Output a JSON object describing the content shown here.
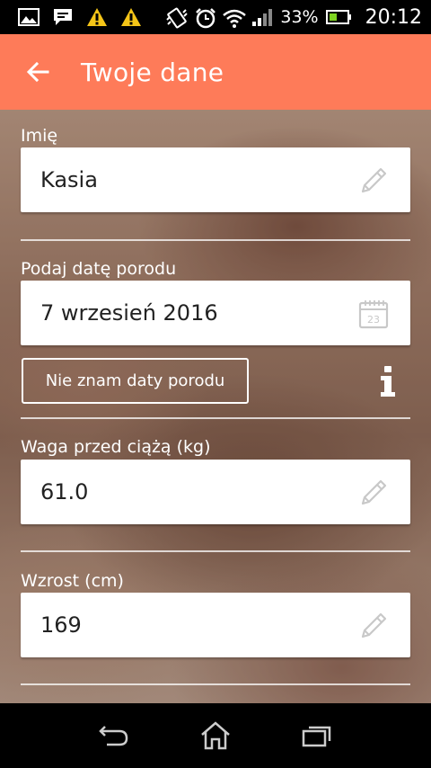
{
  "status_bar": {
    "battery_percent": "33%",
    "time": "20:12"
  },
  "app_bar": {
    "title": "Twoje dane"
  },
  "form": {
    "name": {
      "label": "Imię",
      "value": "Kasia"
    },
    "due_date": {
      "label": "Podaj datę porodu",
      "value": "7 wrzesień 2016",
      "calendar_day": "23"
    },
    "unknown_date_button": "Nie znam daty porodu",
    "info_glyph": "i",
    "weight": {
      "label": "Waga przed ciążą (kg)",
      "value": "61.0"
    },
    "height": {
      "label": "Wzrost (cm)",
      "value": "169"
    }
  },
  "icons": {
    "status_left": [
      "gallery-icon",
      "message-icon",
      "warning-icon",
      "warning-icon"
    ],
    "status_right": [
      "vibrate-icon",
      "alarm-icon",
      "wifi-icon",
      "signal-icon",
      "battery-icon"
    ],
    "field_edit": "pencil-icon",
    "field_date": "calendar-icon",
    "nav": [
      "back-icon",
      "home-icon",
      "recent-apps-icon"
    ]
  },
  "colors": {
    "app_bar": "#fe7b59",
    "warning": "#f5c518",
    "battery_fill": "#7ed321"
  }
}
